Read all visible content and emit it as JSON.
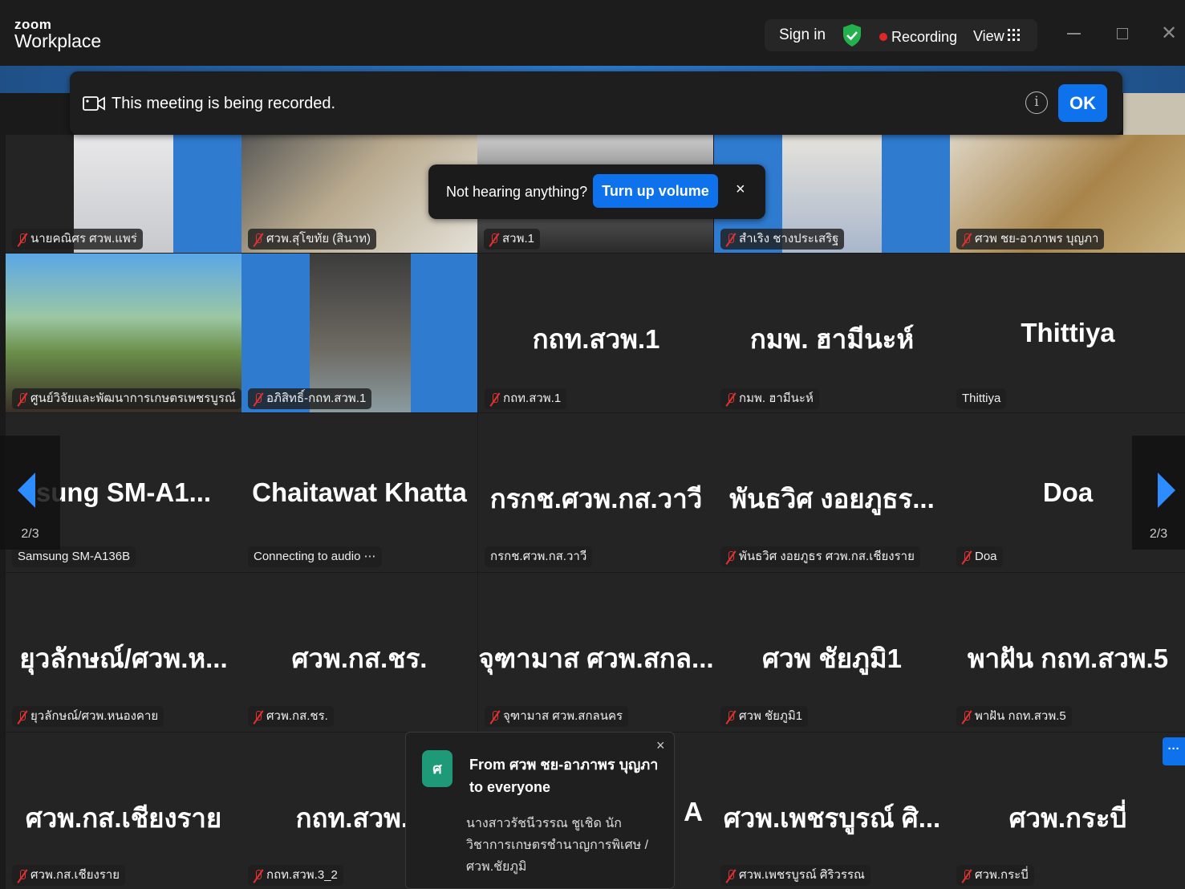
{
  "app": {
    "logo_top": "zoom",
    "logo_bottom": "Workplace"
  },
  "toolbar": {
    "sign_in": "Sign in",
    "recording": "Recording",
    "view": "View"
  },
  "recording_banner": {
    "message": "This meeting is being recorded.",
    "ok": "OK"
  },
  "volume_prompt": {
    "question": "Not hearing anything?",
    "button": "Turn up volume",
    "close": "×"
  },
  "pagination": {
    "left": "2/3",
    "right": "2/3"
  },
  "participants": {
    "r1": [
      {
        "tag": "นายคณิศร ศวพ.แพร่"
      },
      {
        "tag": "ศวพ.สุโขทัย (สินาท)"
      },
      {
        "tag": "สวพ.1"
      },
      {
        "tag": "สำเริง  ชางประเสริฐ"
      },
      {
        "tag": "ศวพ ชย-อาภาพร บุญภา"
      }
    ],
    "r2": [
      {
        "tag": "ศูนย์วิจัยและพัฒนาการเกษตรเพชรบูรณ์"
      },
      {
        "tag": "อภิสิทธิ์-กถท.สวพ.1"
      },
      {
        "big": "กถท.สวพ.1",
        "tag": "กถท.สวพ.1"
      },
      {
        "big": "กมพ. ฮามีนะห์",
        "tag": "กมพ. ฮามีนะห์"
      },
      {
        "big": "Thittiya",
        "tag": "Thittiya"
      }
    ],
    "r3": [
      {
        "big": "sung  SM-A1...",
        "tag": "Samsung SM-A136B"
      },
      {
        "big": "Chaitawat Khatta",
        "tag": "Connecting to audio ⋯"
      },
      {
        "big": "กรกช.ศวพ.กส.วาวี",
        "tag": "กรกช.ศวพ.กส.วาวี"
      },
      {
        "big": "พันธวิศ  งอยภูธร...",
        "tag": "พันธวิศ  งอยภูธร ศวพ.กส.เชียงราย"
      },
      {
        "big": "Doa",
        "tag": "Doa"
      }
    ],
    "r4": [
      {
        "big": "ยุวลักษณ์/ศวพ.ห...",
        "tag": "ยุวลักษณ์/ศวพ.หนองคาย"
      },
      {
        "big": "ศวพ.กส.ชร.",
        "tag": "ศวพ.กส.ชร."
      },
      {
        "big": "จุฑามาส ศวพ.สกล...",
        "tag": "จุฑามาส ศวพ.สกลนคร"
      },
      {
        "big": "ศวพ ชัยภูมิ1",
        "tag": "ศวพ ชัยภูมิ1"
      },
      {
        "big": "พาฝัน กถท.สวพ.5",
        "tag": "พาฝัน กถท.สวพ.5"
      }
    ],
    "r5": [
      {
        "big": "ศวพ.กส.เชียงราย",
        "tag": "ศวพ.กส.เชียงราย"
      },
      {
        "big": "กถท.สวพ.3",
        "tag": "กถท.สวพ.3_2"
      },
      {
        "big": "A",
        "tag": ""
      },
      {
        "big": "ศวพ.เพชรบูรณ์ ศิ...",
        "tag": "ศวพ.เพชรบูรณ์ ศิริวรรณ"
      },
      {
        "big": "ศวพ.กระบี่",
        "tag": "ศวพ.กระบี่"
      }
    ]
  },
  "chat": {
    "avatar": "ศ",
    "from": "From ศวพ ชย-อาภาพร บุญภา to everyone",
    "message": "นางสาวรัชนีวรรณ ชูเชิด นักวิชาการเกษตรชำนาญการพิเศษ /ศวพ.ชัยภูมิ",
    "close": "×"
  },
  "more_button": "···",
  "colors": {
    "accent": "#0e72ed",
    "muted_mic": "#e13232",
    "chat_avatar": "#1f9a78"
  }
}
